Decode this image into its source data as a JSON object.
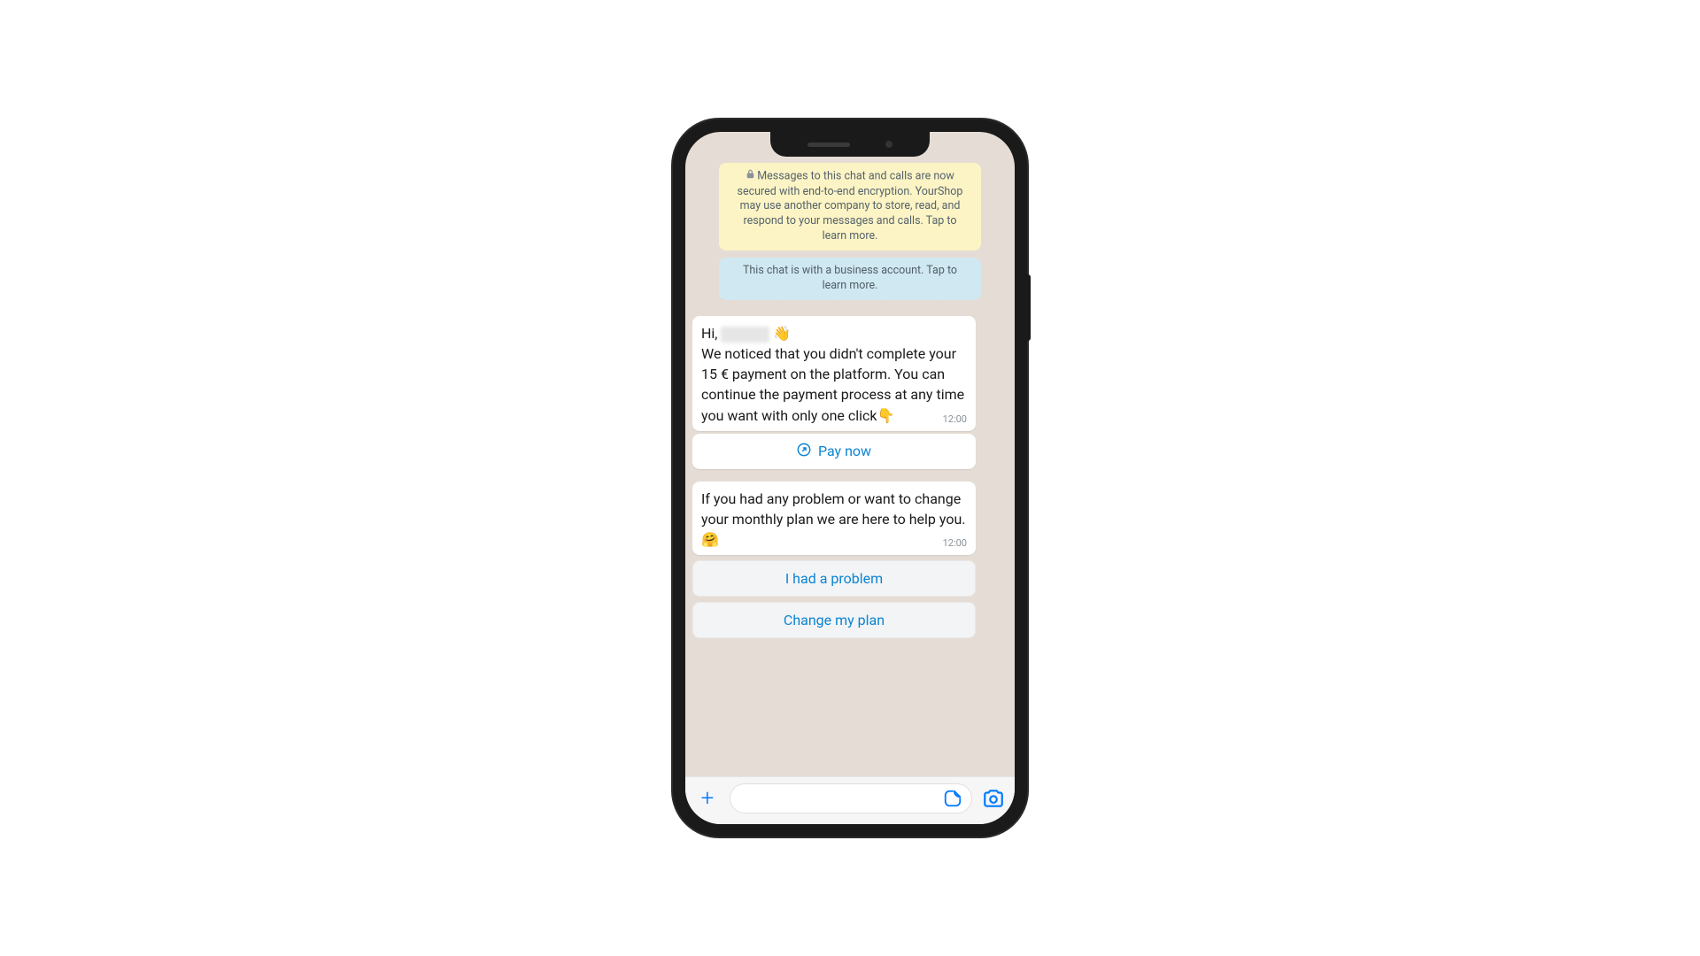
{
  "banners": {
    "encryption": "Messages to this chat and calls are now secured with end-to-end encryption. YourShop may use another company to store, read, and respond to your messages and calls. Tap to learn more.",
    "business": "This chat is with a business account. Tap to learn more."
  },
  "messages": [
    {
      "body_prefix": "Hi, ",
      "body_after_name": " 👋\nWe noticed that you didn't complete your 15 € payment on the platform. You can continue the payment process at any time you want with only one click👇",
      "time": "12:00",
      "action": "Pay now"
    },
    {
      "body": "If you had any problem or want to change your monthly plan we are here to help you. 🤗",
      "time": "12:00",
      "quick_replies": [
        "I had a problem",
        "Change my plan"
      ]
    }
  ],
  "input": {
    "placeholder": ""
  }
}
